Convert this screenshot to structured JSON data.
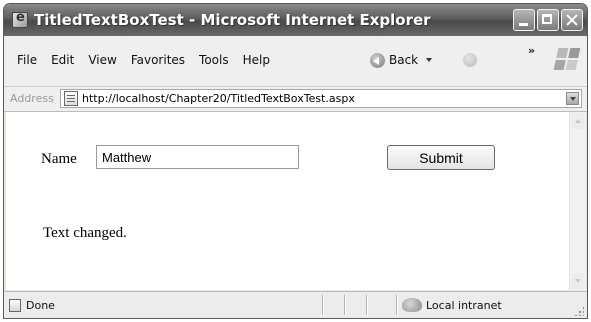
{
  "window": {
    "title": "TitledTextBoxTest - Microsoft Internet Explorer"
  },
  "menu": {
    "items": [
      "File",
      "Edit",
      "View",
      "Favorites",
      "Tools",
      "Help"
    ],
    "back_label": "Back",
    "overflow": "»"
  },
  "address": {
    "label": "Address",
    "url": "http://localhost/Chapter20/TitledTextBoxTest.aspx"
  },
  "form": {
    "name_label": "Name",
    "name_value": "Matthew",
    "submit_label": "Submit",
    "status_message": "Text changed."
  },
  "statusbar": {
    "status": "Done",
    "zone": "Local intranet"
  },
  "icons": {
    "page": "page-icon",
    "back": "back-arrow-icon",
    "forward": "forward-arrow-icon",
    "zone": "intranet-globe-icon"
  }
}
